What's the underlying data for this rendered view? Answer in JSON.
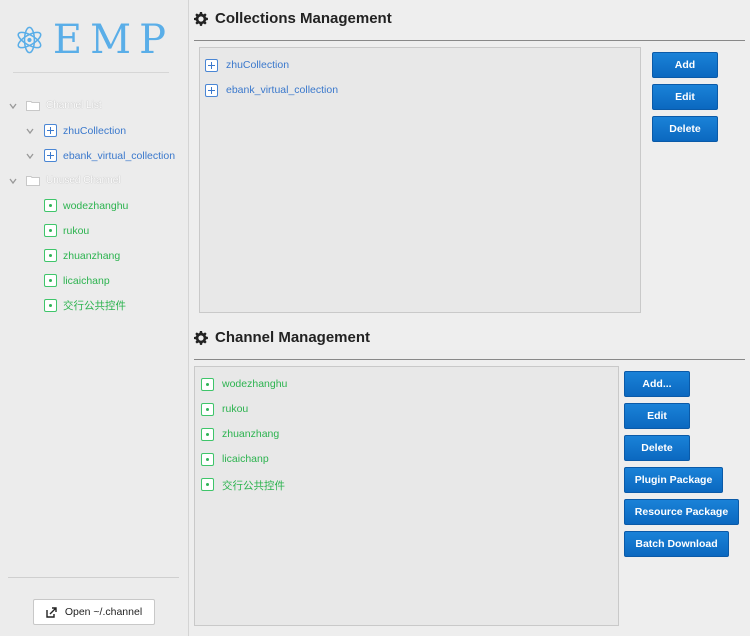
{
  "logo": {
    "text": "EMP"
  },
  "sidebar": {
    "tree": [
      {
        "type": "folder",
        "label": "Channel List"
      },
      {
        "type": "collection",
        "label": "zhuCollection"
      },
      {
        "type": "collection",
        "label": "ebank_virtual_collection"
      },
      {
        "type": "folder",
        "label": "Unused Channel"
      },
      {
        "type": "channel",
        "label": "wodezhanghu"
      },
      {
        "type": "channel",
        "label": "rukou"
      },
      {
        "type": "channel",
        "label": "zhuanzhang"
      },
      {
        "type": "channel",
        "label": "licaichanp"
      },
      {
        "type": "channel",
        "label": "交行公共控件"
      }
    ],
    "open_button": "Open ~/.channel"
  },
  "collections": {
    "title": "Collections Management",
    "items": [
      "zhuCollection",
      "ebank_virtual_collection"
    ],
    "buttons": {
      "add": "Add",
      "edit": "Edit",
      "delete": "Delete"
    }
  },
  "channels": {
    "title": "Channel Management",
    "items": [
      "wodezhanghu",
      "rukou",
      "zhuanzhang",
      "licaichanp",
      "交行公共控件"
    ],
    "buttons": {
      "add": "Add...",
      "edit": "Edit",
      "delete": "Delete",
      "plugin": "Plugin Package",
      "resource": "Resource Package",
      "batch": "Batch Download"
    }
  },
  "colors": {
    "accent_button": "#0b6fc6",
    "collection_text": "#3a78cc",
    "channel_text": "#2cb34f",
    "logo": "#5aaee8"
  }
}
